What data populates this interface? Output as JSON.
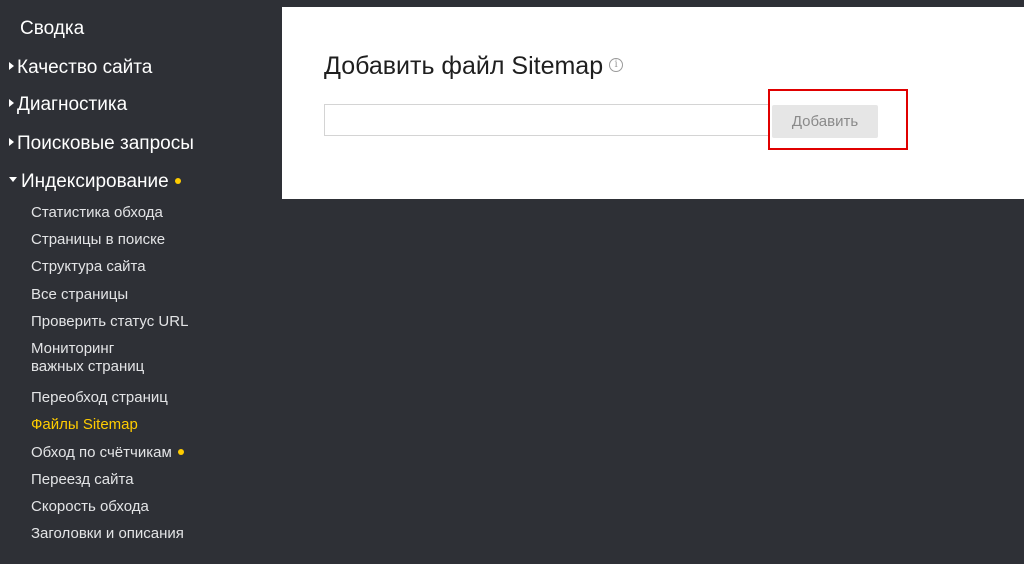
{
  "sidebar": {
    "top_items": [
      {
        "label": "Сводка"
      },
      {
        "label": "Качество сайта"
      },
      {
        "label": "Диагностика"
      },
      {
        "label": "Поисковые запросы"
      },
      {
        "label": "Индексирование"
      }
    ],
    "sub_items": [
      {
        "label": "Статистика обхода"
      },
      {
        "label": "Страницы в поиске"
      },
      {
        "label": "Структура сайта"
      },
      {
        "label": "Все страницы"
      },
      {
        "label": "Проверить статус URL"
      },
      {
        "label": "Мониторинг важных страниц"
      },
      {
        "label": "Переобход страниц"
      },
      {
        "label": "Файлы Sitemap"
      },
      {
        "label": "Обход по счётчикам"
      },
      {
        "label": "Переезд сайта"
      },
      {
        "label": "Скорость обхода"
      },
      {
        "label": "Заголовки и описания"
      }
    ],
    "active_item": "Файлы Sitemap",
    "accent_color": "#ffcc00",
    "background_color": "#2e3036"
  },
  "main": {
    "title": "Добавить файл Sitemap",
    "info_icon": "info-icon",
    "input": {
      "value": "",
      "placeholder": ""
    },
    "add_button_label": "Добавить",
    "highlight_color": "#e00000"
  }
}
